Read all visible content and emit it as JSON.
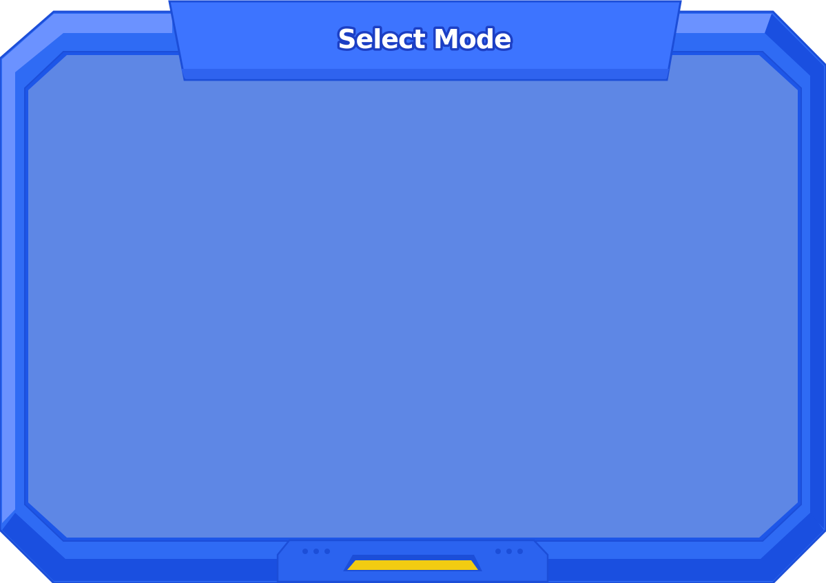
{
  "panel": {
    "title": "Select Mode"
  },
  "colors": {
    "frame_main": "#2f6bf4",
    "frame_dark": "#1a4fe0",
    "frame_light": "#6b92ff",
    "frame_outline": "#1c4ed8",
    "content_fill": "#5e87e5",
    "title_tab": "#3d74ff",
    "accent_yellow": "#f2cc12"
  },
  "icons": {
    "left_dots": "indicator-dots-icon",
    "right_dots": "indicator-dots-icon"
  }
}
